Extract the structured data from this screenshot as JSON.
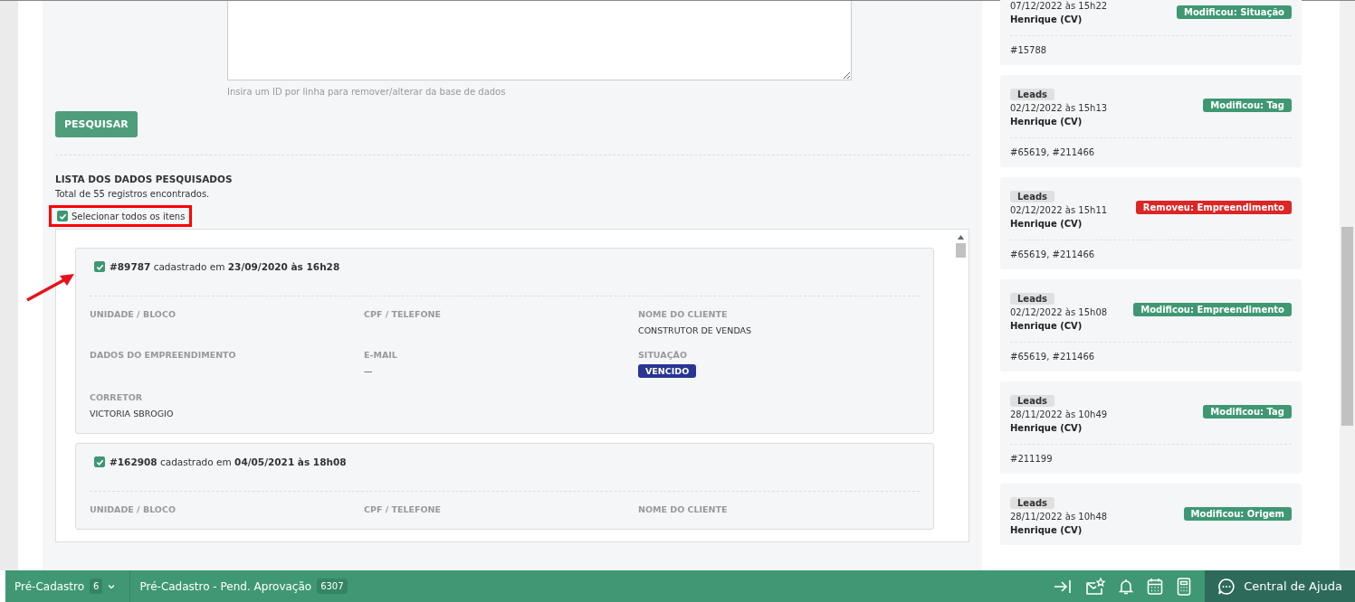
{
  "search_form": {
    "hint": "Insira um ID por linha para remover/alterar da base de dados",
    "search_button": "PESQUISAR"
  },
  "results": {
    "heading": "LISTA DOS DADOS PESQUISADOS",
    "total": "Total de 55 registros encontrados.",
    "select_all": {
      "label": "Selecionar todos os itens",
      "checked": true
    },
    "records": [
      {
        "title": "**#89787** cadastrado em **23/09/2020 às 16h28**",
        "checked": true,
        "fields": [
          {
            "label": "UNIDADE / BLOCO",
            "kind": "text"
          },
          {
            "label": "CPF / TELEFONE",
            "kind": "text"
          },
          {
            "label": "NOME DO CLIENTE",
            "kind": "text",
            "value": "CONSTRUTOR DE VENDAS"
          },
          {
            "label": "DADOS DO EMPREENDIMENTO",
            "kind": "text"
          },
          {
            "label": "E-MAIL",
            "kind": "text",
            "value": "—"
          },
          {
            "label": "SITUAÇÃO",
            "kind": "badge",
            "value": "VENCIDO"
          },
          {
            "label": "CORRETOR",
            "kind": "text",
            "value": "VICTORIA SBROGIO"
          }
        ]
      },
      {
        "title": "**#162908** cadastrado em **04/05/2021 às 18h08**",
        "checked": true,
        "fields": [
          {
            "label": "UNIDADE / BLOCO",
            "kind": "text"
          },
          {
            "label": "CPF / TELEFONE",
            "kind": "text"
          },
          {
            "label": "NOME DO CLIENTE",
            "kind": "text"
          }
        ]
      }
    ]
  },
  "history": [
    {
      "date": "07/12/2022 às 15h22",
      "user": "Henrique (CV)",
      "action": "Modificou: Situação",
      "color": "#3f9873",
      "ids": "#15788"
    },
    {
      "tag": "Leads",
      "date": "02/12/2022 às 15h13",
      "user": "Henrique (CV)",
      "action": "Modificou: Tag",
      "color": "#3f9873",
      "ids": "#65619, #211466"
    },
    {
      "tag": "Leads",
      "date": "02/12/2022 às 15h11",
      "user": "Henrique (CV)",
      "action": "Removeu: Empreendimento",
      "color": "#dc2626",
      "ids": "#65619, #211466"
    },
    {
      "tag": "Leads",
      "date": "02/12/2022 às 15h08",
      "user": "Henrique (CV)",
      "action": "Modificou: Empreendimento",
      "color": "#3f9873",
      "ids": "#65619, #211466"
    },
    {
      "tag": "Leads",
      "date": "28/11/2022 às 10h49",
      "user": "Henrique (CV)",
      "action": "Modificou: Tag",
      "color": "#3f9873",
      "ids": "#211199"
    },
    {
      "tag": "Leads",
      "date": "28/11/2022 às 10h48",
      "user": "Henrique (CV)",
      "action": "Modificou: Origem",
      "color": "#3f9873"
    }
  ],
  "bottom_bar": {
    "tabs": [
      {
        "label": "Pré-Cadastro",
        "count": "6",
        "dropdown": true
      },
      {
        "label": "Pré-Cadastro - Pend. Aprovação",
        "count": "6307",
        "dropdown": false
      }
    ],
    "help": "Central de Ajuda"
  }
}
